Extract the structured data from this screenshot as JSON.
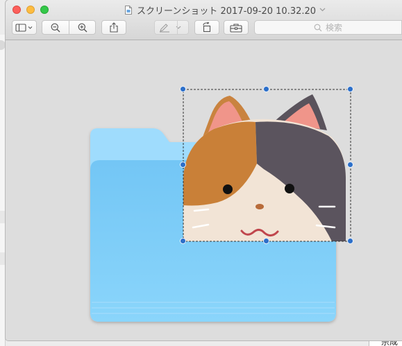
{
  "window": {
    "title": "スクリーンショット 2017-09-20 10.32.20"
  },
  "toolbar": {
    "sidebar_button": "sidebar-toggle",
    "zoom_out": "zoom-out",
    "zoom_in": "zoom-in",
    "share": "share",
    "markup": "markup",
    "rotate": "rotate",
    "toolbox": "toolbox"
  },
  "search": {
    "placeholder": "検索"
  },
  "background": {
    "partial_text": "宗成"
  },
  "colors": {
    "selection_handle": "#2c6fc9",
    "folder_light": "#9fdcfd",
    "folder_main": "#79ccf8",
    "close": "#fc605c",
    "minimize": "#fdbc40",
    "zoom": "#34c84a"
  }
}
